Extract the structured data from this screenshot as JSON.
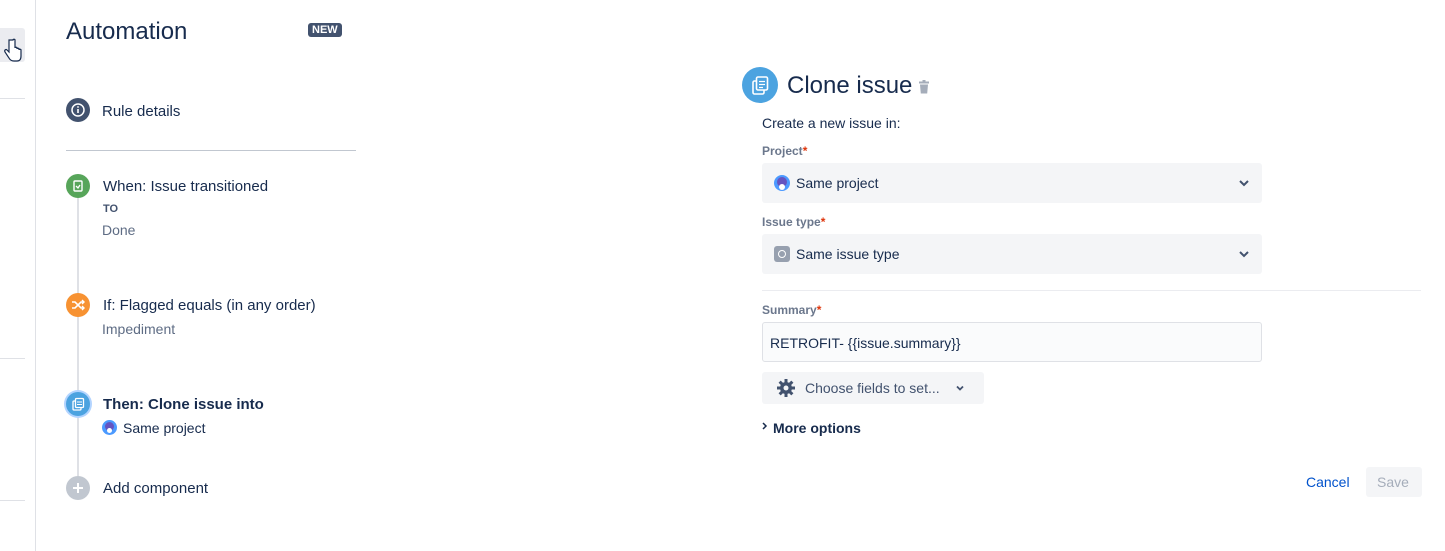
{
  "sidebar": {
    "title": "Automation",
    "badge": "NEW",
    "rule_details": "Rule details",
    "steps": [
      {
        "title": "When: Issue transitioned",
        "caption": "TO",
        "sub": "Done",
        "color": "#57a55a",
        "icon": "trigger-icon"
      },
      {
        "title": "If: Flagged equals (in any order)",
        "sub": "Impediment",
        "color": "#f79232",
        "icon": "shuffle-icon"
      },
      {
        "title": "Then: Clone issue into",
        "sub": "Same project",
        "color": "#4ca3e0",
        "icon": "clone-icon"
      },
      {
        "title": "Add component",
        "color": "#c1c7d0",
        "icon": "plus-icon"
      }
    ]
  },
  "panel": {
    "title": "Clone issue",
    "create_text": "Create a new issue in:",
    "project_label": "Project",
    "project_value": "Same project",
    "issue_type_label": "Issue type",
    "issue_type_value": "Same issue type",
    "summary_label": "Summary",
    "summary_value": "RETROFIT- {{issue.summary}}",
    "choose_fields": "Choose fields to set...",
    "more_options": "More options",
    "cancel": "Cancel",
    "save": "Save",
    "required_mark": "*"
  }
}
